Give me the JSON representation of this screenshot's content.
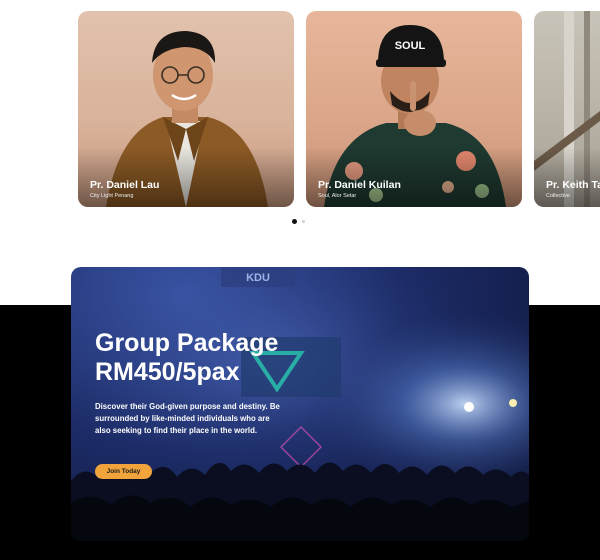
{
  "speakers": [
    {
      "name": "Pr. Daniel Lau",
      "church": "City Light Penang"
    },
    {
      "name": "Pr. Daniel Kuilan",
      "church": "Soul, Alor Setar",
      "cap_text": "SOUL"
    },
    {
      "name": "Pr. Keith Ta",
      "church": "Collective"
    }
  ],
  "carousel": {
    "active_index": 0,
    "dot_count": 2
  },
  "banner": {
    "sign_text": "KDU",
    "title_line1": "Group Package",
    "title_line2": "RM450/5pax",
    "description": "Discover their God-given purpose and destiny. Be surrounded by like-minded individuals who are also seeking to find their place in the world.",
    "button_label": "Join Today"
  },
  "colors": {
    "button": "#f1a43b",
    "dark_band": "#000000",
    "banner_blue": "#1c2b66"
  }
}
